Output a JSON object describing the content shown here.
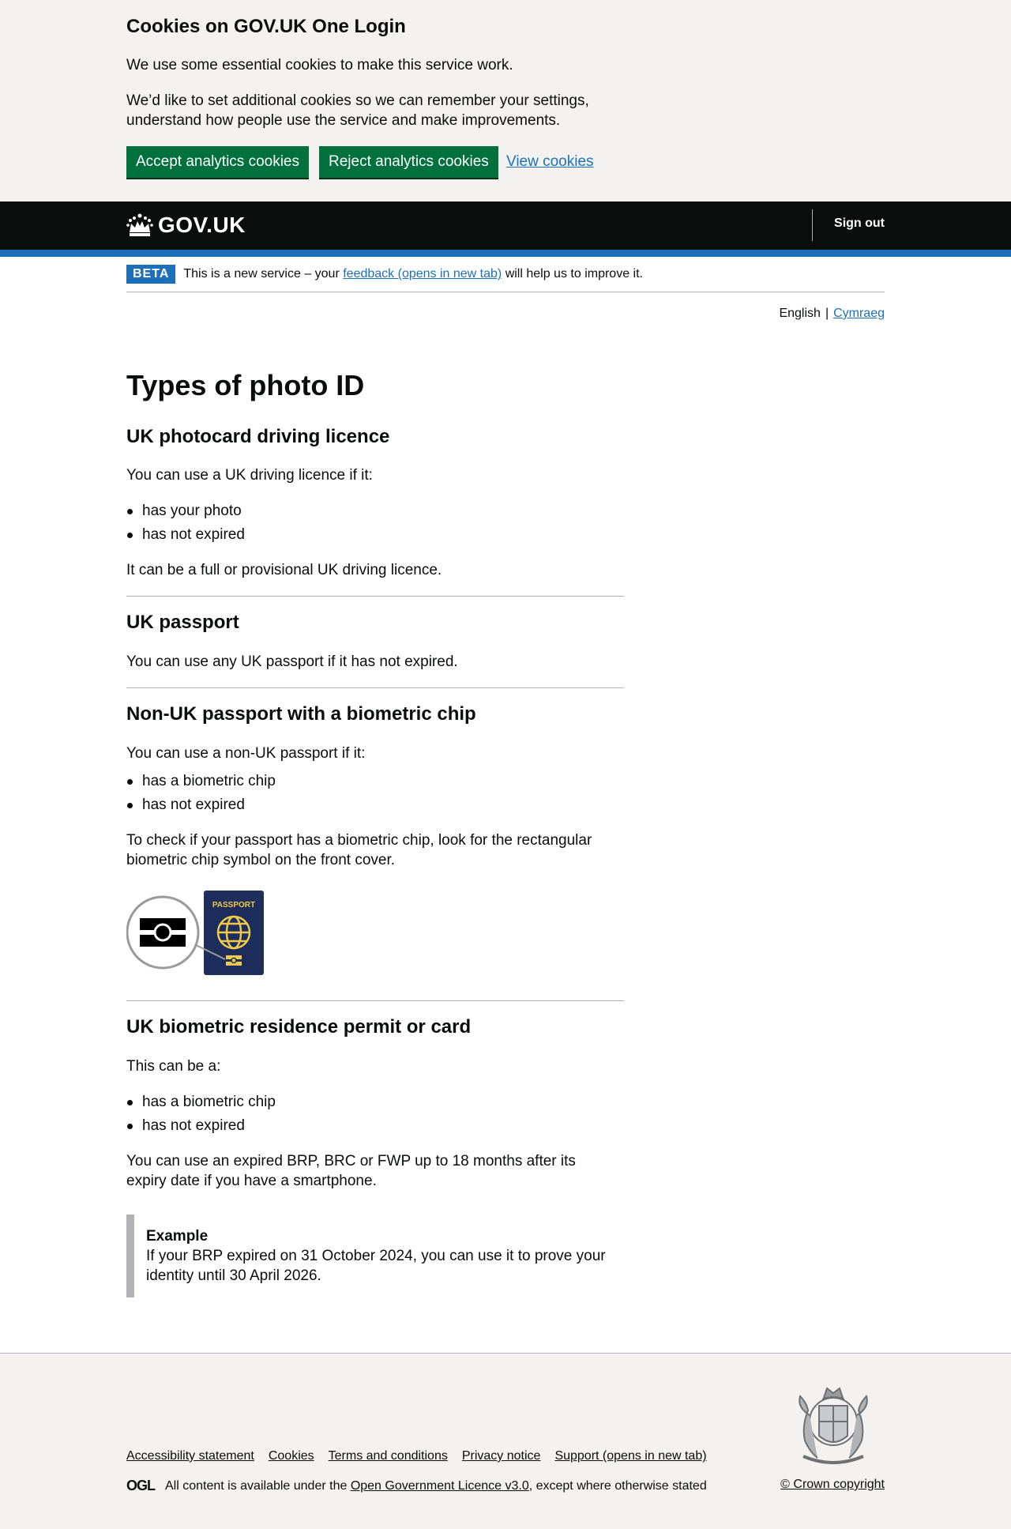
{
  "cookie_banner": {
    "title": "Cookies on GOV.UK One Login",
    "p1": "We use some essential cookies to make this service work.",
    "p2": "We’d like to set additional cookies so we can remember your settings, understand how people use the service and make improvements.",
    "accept": "Accept analytics cookies",
    "reject": "Reject analytics cookies",
    "view": "View cookies"
  },
  "header": {
    "logo": "GOV.UK",
    "sign_out": "Sign out"
  },
  "beta": {
    "tag": "BETA",
    "before": "This is a new service – your ",
    "link": "feedback (opens in new tab)",
    "after": " will help us to improve it."
  },
  "language": {
    "current": "English",
    "separator": "|",
    "other": "Cymraeg"
  },
  "main": {
    "title": "Types of photo ID",
    "driving": {
      "heading": "UK photocard driving licence",
      "intro": "You can use a UK driving licence if it:",
      "bullets": [
        "has your photo",
        "has not expired"
      ],
      "note": "It can be a full or provisional UK driving licence."
    },
    "passport": {
      "heading": "UK passport",
      "text": "You can use any UK passport if it has not expired."
    },
    "nonuk": {
      "heading": "Non-UK passport with a biometric chip",
      "intro": "You can use a non-UK passport if it:",
      "bullets": [
        "has a biometric chip",
        "has not expired"
      ],
      "check": "To check if your passport has a biometric chip, look for the rectangular biometric chip symbol on the front cover.",
      "passport_label": "PASSPORT"
    },
    "brp": {
      "heading": "UK biometric residence permit or card",
      "intro": "This can be a:",
      "bullets": [
        "has a biometric chip",
        "has not expired"
      ],
      "text": "You can use an expired BRP, BRC or FWP up to 18 months after its expiry date if you have a smartphone.",
      "example_title": "Example",
      "example_text": "If your BRP expired on 31 October 2024, you can use it to prove your identity until 30 April 2026."
    }
  },
  "footer": {
    "links": [
      "Accessibility statement",
      "Cookies",
      "Terms and conditions",
      "Privacy notice",
      "Support (opens in new tab)"
    ],
    "ogl": "OGL",
    "licence_before": "All content is available under the ",
    "licence_link": "Open Government Licence v3.0",
    "licence_after": ", except where otherwise stated",
    "copyright": "© Crown copyright"
  },
  "colors": {
    "link": "#1d70b8",
    "button": "#00703c",
    "header": "#0b0c0c",
    "accent": "#1d70b8"
  }
}
